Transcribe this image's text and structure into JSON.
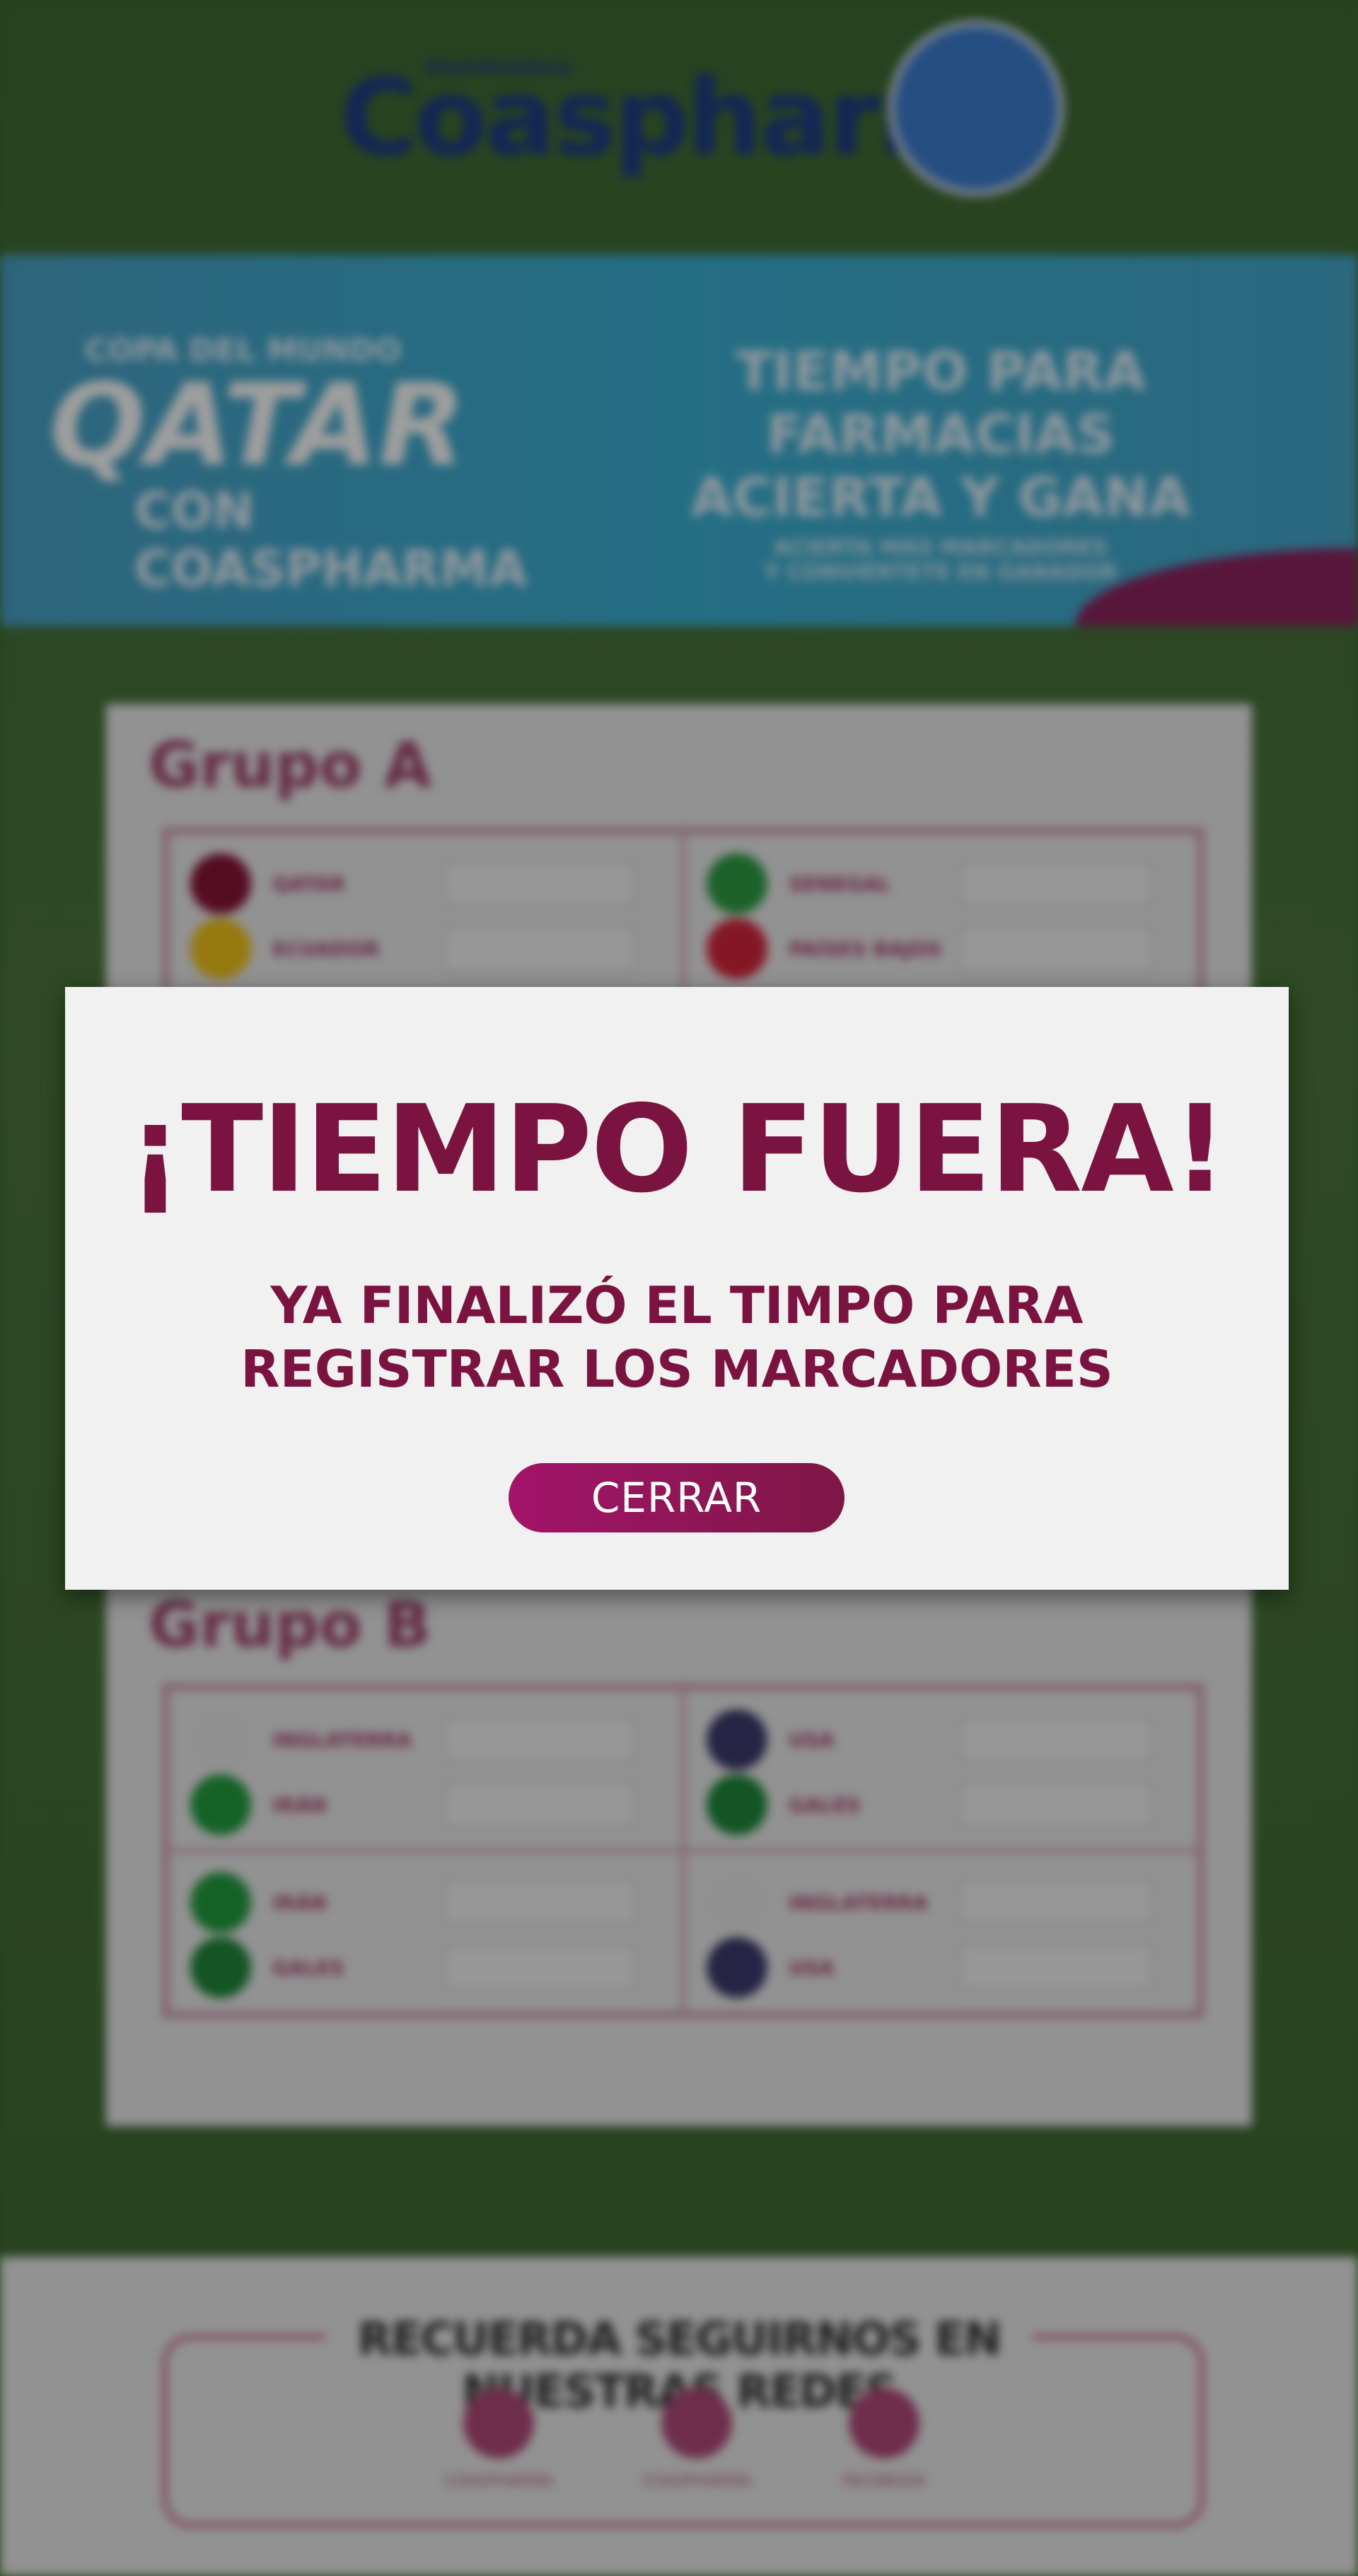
{
  "header": {
    "logo_small_text": "Distribuidora",
    "logo_text": "Coaspharma"
  },
  "banner": {
    "line1": "COPA DEL MUNDO",
    "line2": "QATAR",
    "line3": "CON COASPHARMA",
    "right_line1": "TIEMPO PARA FARMACIAS",
    "right_line2": "ACIERTA Y GANA",
    "right_line3": "ACIERTA MÁS MARCADORES",
    "right_line4": "Y CONVIÉRTETE EN GANADOR"
  },
  "groups": [
    {
      "title": "Grupo A",
      "matches": [
        {
          "home": "QATAR",
          "away": "ECUADOR",
          "home_color": "#8a1538",
          "away_color": "#f0c419"
        },
        {
          "home": "SENEGAL",
          "away": "PAÍSES BAJOS",
          "home_color": "#2e9e44",
          "away_color": "#d7263d"
        }
      ]
    },
    {
      "title": "Grupo B",
      "matches": [
        {
          "home": "INGLATERRA",
          "away": "IRÁN",
          "home_color": "#e8e8e8",
          "away_color": "#239f40"
        },
        {
          "home": "USA",
          "away": "GALES",
          "home_color": "#3c3b6e",
          "away_color": "#1f8a3a"
        },
        {
          "home": "IRÁN",
          "away": "GALES",
          "home_color": "#239f40",
          "away_color": "#1f8a3a"
        },
        {
          "home": "INGLATERRA",
          "away": "USA",
          "home_color": "#e8e8e8",
          "away_color": "#3c3b6e"
        }
      ]
    }
  ],
  "footer": {
    "title": "RECUERDA SEGUIRNOS EN NUESTRAS REDES",
    "socials": [
      "COASPHARMA",
      "COASPHARMA",
      "FACEBOOK"
    ]
  },
  "modal": {
    "title": "¡TIEMPO FUERA!",
    "message_line1": "YA FINALIZÓ EL TIMPO PARA",
    "message_line2": "REGISTRAR LOS MARCADORES",
    "close_label": "CERRAR"
  },
  "colors": {
    "accent": "#7b1341",
    "button_start": "#a3146a",
    "button_end": "#7e1746",
    "modal_bg": "#f1f1f1"
  }
}
